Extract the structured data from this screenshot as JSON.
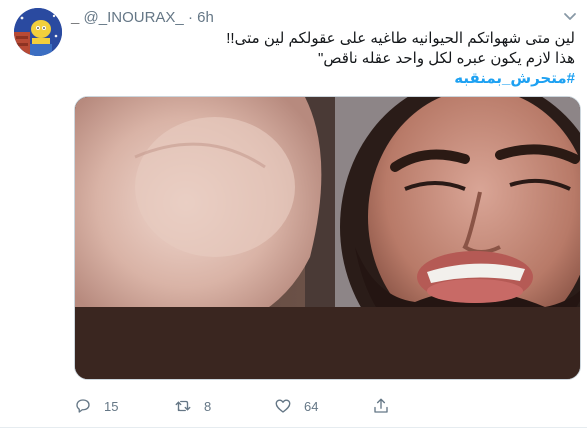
{
  "tweet": {
    "display_name": "_",
    "handle": "@_INOURAX_",
    "separator": "·",
    "time": "6h",
    "lines": [
      "لين متى شهواتكم الحيوانيه طاغيه على عقولكم لين متى!!",
      "هذا لازم يكون عبره لكل واحد عقله ناقص\""
    ],
    "hashtag": "#متحرش_بمنقبه"
  },
  "media": {
    "description_icon": "video-thumbnail"
  },
  "actions": {
    "replies": "15",
    "retweets": "8",
    "likes": "64"
  },
  "colors": {
    "accent": "#1da1f2",
    "muted": "#657786",
    "text": "#14171a"
  }
}
